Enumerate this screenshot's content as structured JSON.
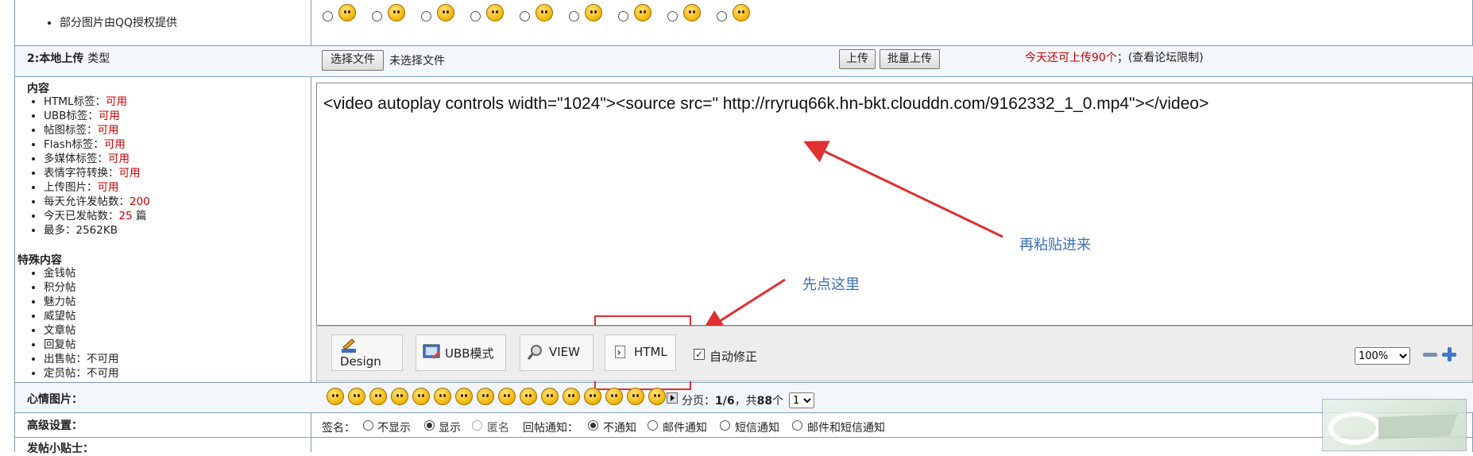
{
  "top_row": {
    "provider_note": "部分图片由QQ授权提供"
  },
  "upload_row": {
    "label_bold": "2:本地上传",
    "label_type": "类型",
    "choose_file": "选择文件",
    "no_file": "未选择文件",
    "upload": "上传",
    "batch_upload": "批量上传",
    "quota": "今天还可上传90个",
    "limit_link": "；(查看论坛限制)"
  },
  "content_section": {
    "title": "内容",
    "items": [
      {
        "label": "HTML标签：",
        "value": "可用"
      },
      {
        "label": "UBB标签：",
        "value": "可用"
      },
      {
        "label": "帖图标签：",
        "value": "可用"
      },
      {
        "label": "Flash标签：",
        "value": "可用"
      },
      {
        "label": "多媒体标签：",
        "value": "可用"
      },
      {
        "label": "表情字符转换：",
        "value": "可用"
      },
      {
        "label": "上传图片：",
        "value": "可用"
      },
      {
        "label": "每天允许发帖数：",
        "value": "200"
      },
      {
        "label": "今天已发帖数：",
        "value": "25",
        "suffix": " 篇"
      },
      {
        "label": "最多：2562KB",
        "value": ""
      }
    ]
  },
  "special_section": {
    "title": "特殊内容",
    "items": [
      "金钱帖",
      "积分帖",
      "魅力帖",
      "威望帖",
      "文章帖",
      "回复帖",
      "出售帖：不可用",
      "定员帖：不可用"
    ]
  },
  "editor": {
    "content": "<video autoplay controls width=\"1024\"><source src=\" http://rryruq66k.hn-bkt.clouddn.com/9162332_1_0.mp4\"></video>"
  },
  "annotations": {
    "paste": "再粘贴进来",
    "click_first": "先点这里"
  },
  "toolbar": {
    "design": "Design",
    "ubb": "UBB模式",
    "view": "VIEW",
    "html": "HTML",
    "auto_fix": "自动修正",
    "zoom": "100%"
  },
  "mood_row": {
    "label": "心情图片：",
    "page_prefix": "分页：",
    "page": "1/6",
    "total_mid": "，共",
    "total": "88",
    "total_suffix": "个",
    "page_select": "1"
  },
  "advanced_row": {
    "label": "高级设置：",
    "sig_label": "签名：",
    "hide": "不显示",
    "show": "显示",
    "anon": "匿名",
    "notify_label": "回帖通知：",
    "no_notify": "不通知",
    "mail": "邮件通知",
    "sms": "短信通知",
    "mail_sms": "邮件和短信通知"
  },
  "tips_row": {
    "label": "发帖小贴士："
  },
  "colors": {
    "accent_red": "#cc0000",
    "annotation_blue": "#3b6fb6",
    "arrow_red": "#e03030",
    "border": "#7f9db9"
  }
}
